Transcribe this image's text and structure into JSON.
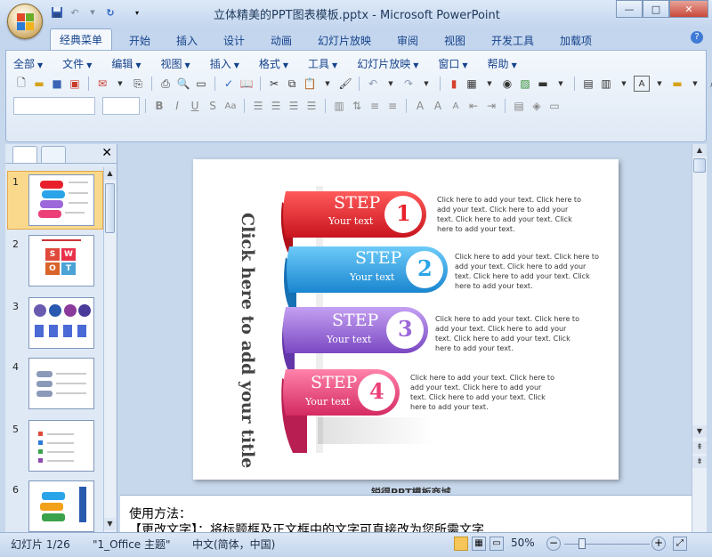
{
  "window": {
    "title": "立体精美的PPT图表模板.pptx - Microsoft PowerPoint",
    "buttons": [
      "—",
      "□",
      "✕"
    ]
  },
  "ribbon_tabs": [
    "经典菜单",
    "开始",
    "插入",
    "设计",
    "动画",
    "幻灯片放映",
    "审阅",
    "视图",
    "开发工具",
    "加载项"
  ],
  "menu": [
    "全部",
    "文件",
    "编辑",
    "视图",
    "插入",
    "格式",
    "工具",
    "幻灯片放映",
    "窗口",
    "帮助"
  ],
  "slide": {
    "title": "Click here to add your title",
    "steps": [
      {
        "label": "STEP",
        "sub": "Your text",
        "num": "1",
        "color": "#e8202c",
        "desc": "Click here to add your text. Click here to add your text. Click here to add your text. Click here to add your text. Click here to add your text."
      },
      {
        "label": "STEP",
        "sub": "Your text",
        "num": "2",
        "color": "#2aa4e8",
        "desc": "Click here to add your text. Click here to add your text. Click here to add your text. Click here to add your text. Click here to add your text."
      },
      {
        "label": "STEP",
        "sub": "Your text",
        "num": "3",
        "color": "#9b67d9",
        "desc": "Click here to add your text. Click here to add your text. Click here to add your text. Click here to add your text. Click here to add your text."
      },
      {
        "label": "STEP",
        "sub": "Your text",
        "num": "4",
        "color": "#ec3f78",
        "desc": "Click here to add your text. Click here to add your text. Click here to add your text. Click here to add your text. Click here to add your text."
      }
    ],
    "footer_partial": "锐得PPT模板商城"
  },
  "thumbnails": {
    "numbers": [
      "1",
      "2",
      "3",
      "4",
      "5",
      "6"
    ],
    "swot": [
      "S",
      "W",
      "O",
      "T"
    ]
  },
  "notes": {
    "line1": "使用方法：",
    "line2": "【更改文字】：将标题框及正文框中的文字可直接改为您所需文字"
  },
  "status": {
    "slide": "幻灯片 1/26",
    "theme": "\"1_Office 主题\"",
    "lang": "中文(简体，中国)",
    "zoom": "50%"
  },
  "colors": {
    "accent": "#15428b",
    "ribbon_bg": "#dfe9f5",
    "frame": "#c8d8ec"
  }
}
